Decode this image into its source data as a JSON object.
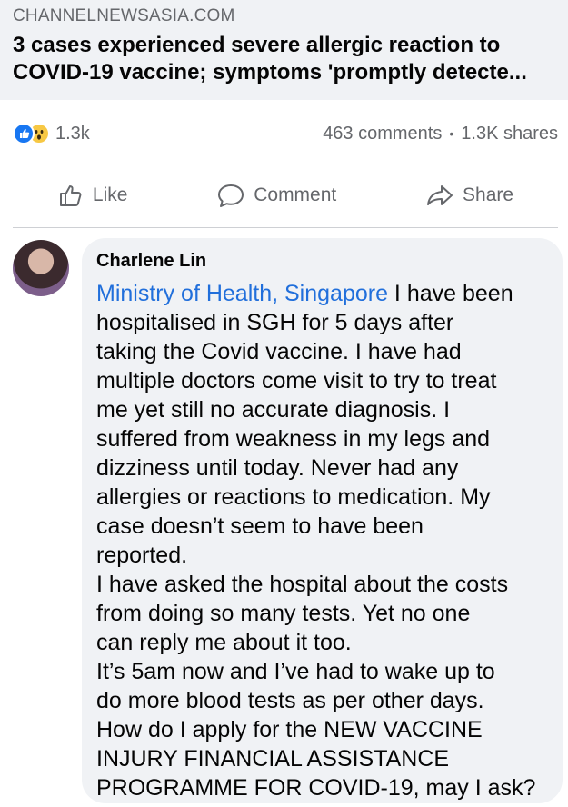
{
  "link_preview": {
    "domain": "CHANNELNEWSASIA.COM",
    "title_line1": "3 cases experienced severe allergic reaction to",
    "title_line2": "COVID-19 vaccine; symptoms 'promptly detecte..."
  },
  "stats": {
    "reaction_count": "1.3k",
    "comments": "463 comments",
    "separator": "•",
    "shares": "1.3K shares",
    "reaction_icons": [
      "like-reaction-icon",
      "wow-reaction-icon"
    ]
  },
  "actions": {
    "like": "Like",
    "comment": "Comment",
    "share": "Share"
  },
  "comment": {
    "author": "Charlene Lin",
    "mention": "Ministry of Health, Singapore",
    "lines": [
      " I have been",
      "hospitalised in SGH for 5 days after",
      "taking the Covid vaccine. I have had",
      "multiple doctors come visit to try to treat",
      "me yet still no accurate diagnosis. I",
      "suffered from weakness in my legs and",
      "dizziness until today. Never had any",
      "allergies or reactions to medication. My",
      "case doesn’t seem to have been",
      "reported.",
      "I have asked the hospital about the costs",
      "from doing so many tests. Yet no one",
      "can reply me about it too.",
      "It’s 5am now and I’ve had to wake up to",
      "do more blood tests as per other days.",
      "How do I apply for the NEW VACCINE",
      "INJURY FINANCIAL ASSISTANCE",
      "PROGRAMME FOR COVID-19, may I ask?"
    ]
  },
  "colors": {
    "link_blue": "#216fdb",
    "muted_gray": "#65676b",
    "bubble_bg": "#f0f2f5",
    "like_blue": "#1877f2",
    "wow_yellow": "#f7c844"
  }
}
